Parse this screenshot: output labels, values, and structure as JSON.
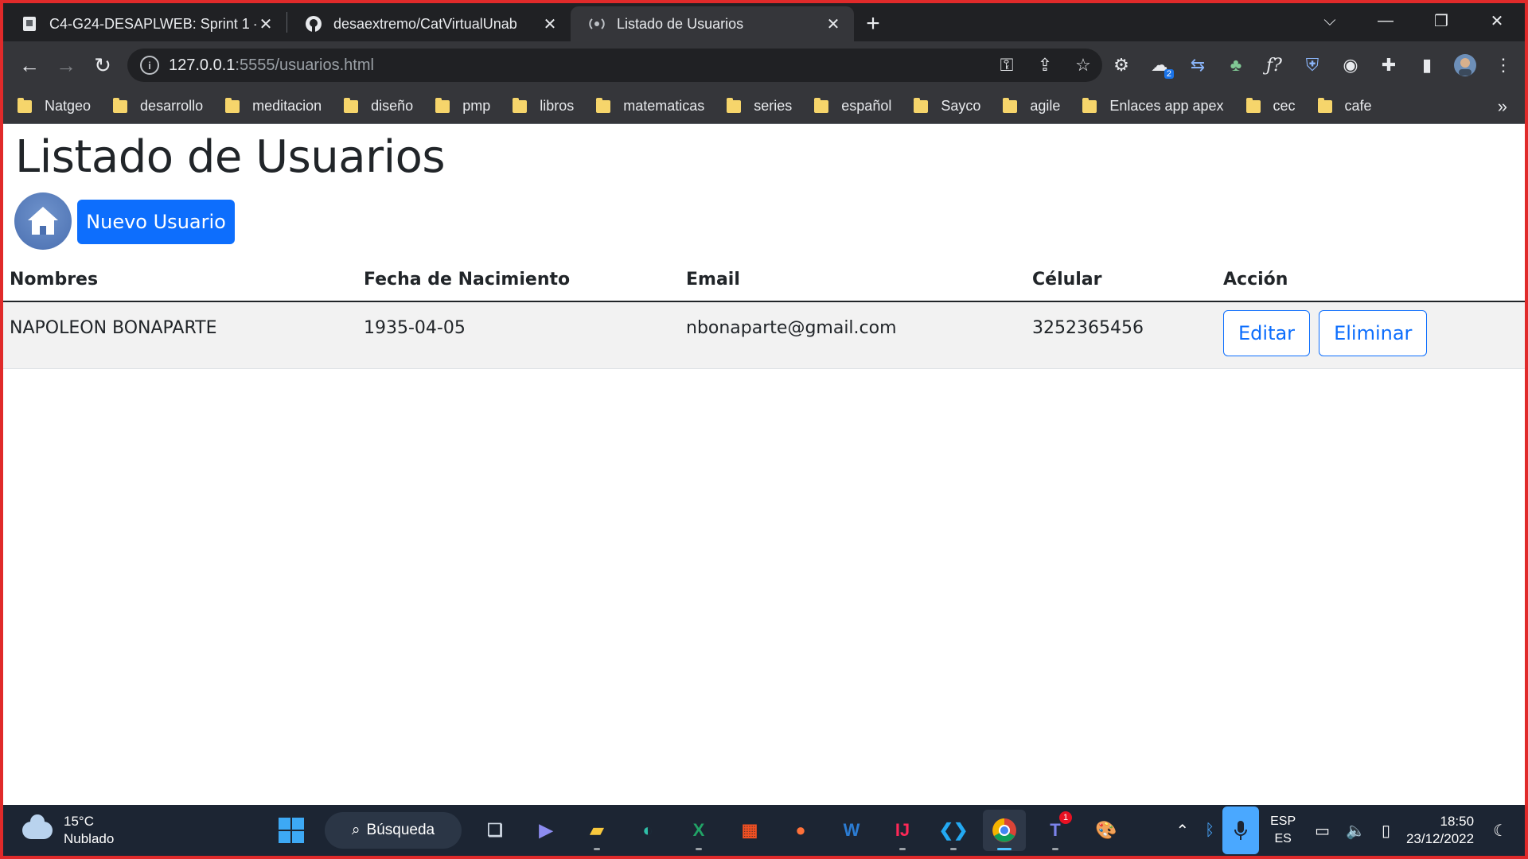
{
  "browser": {
    "tabs": [
      {
        "title": "C4-G24-DESAPLWEB: Sprint 1 - C",
        "active": false
      },
      {
        "title": "desaextremo/CatVirtualUnab",
        "active": false
      },
      {
        "title": "Listado de Usuarios",
        "active": true
      }
    ],
    "url_host": "127.0.0.1",
    "url_path": ":5555/usuarios.html",
    "extension_badge": "2",
    "bookmarks": [
      "Natgeo",
      "desarrollo",
      "meditacion",
      "diseño",
      "pmp",
      "libros",
      "matematicas",
      "series",
      "español",
      "Sayco",
      "agile",
      "Enlaces app apex",
      "cec",
      "cafe"
    ]
  },
  "page": {
    "title": "Listado de Usuarios",
    "new_user_label": "Nuevo Usuario",
    "table": {
      "headers": [
        "Nombres",
        "Fecha de Nacimiento",
        "Email",
        "Célular",
        "Acción"
      ],
      "rows": [
        {
          "nombres": "NAPOLEON BONAPARTE",
          "fecha": "1935-04-05",
          "email": "nbonaparte@gmail.com",
          "celular": "3252365456"
        }
      ],
      "edit_label": "Editar",
      "delete_label": "Eliminar"
    }
  },
  "taskbar": {
    "temperature": "15°C",
    "weather": "Nublado",
    "search_label": "Búsqueda",
    "lang_top": "ESP",
    "lang_bottom": "ES",
    "time": "18:50",
    "date": "23/12/2022",
    "teams_badge": "1"
  }
}
